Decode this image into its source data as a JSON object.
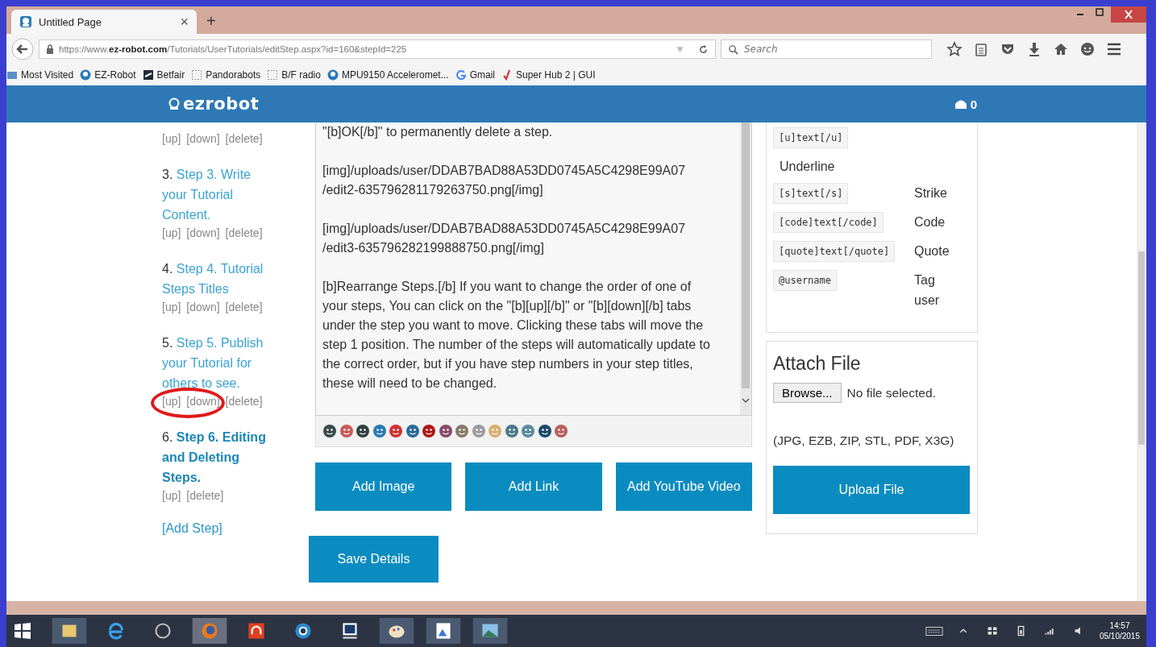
{
  "browser": {
    "tab": {
      "title": "Untitled Page",
      "close": "×"
    },
    "new_tab": "+",
    "url": {
      "prefix": "https://www.",
      "domain": "ez-robot.com",
      "path": "/Tutorials/UserTutorials/editStep.aspx?id=160&stepId=225"
    },
    "search": {
      "placeholder": "Search"
    },
    "bookmarks": [
      {
        "label": "Most Visited",
        "kind": "folder"
      },
      {
        "label": "EZ-Robot",
        "kind": "robot"
      },
      {
        "label": "Betfair",
        "kind": "square"
      },
      {
        "label": "Pandorabots",
        "kind": "blank"
      },
      {
        "label": "B/F radio",
        "kind": "blank"
      },
      {
        "label": "MPU9150 Acceleromet...",
        "kind": "robot"
      },
      {
        "label": "Gmail",
        "kind": "google"
      },
      {
        "label": "Super Hub 2 | GUI",
        "kind": "tick"
      }
    ]
  },
  "header": {
    "logo": "ezrobot",
    "cart_count": "0"
  },
  "steps": [
    {
      "actions": [
        "[up]",
        "[down]",
        "[delete]"
      ]
    },
    {
      "number": "3.",
      "title": "Step 3. Write your Tutorial Content.",
      "selected": false,
      "circled": false,
      "actions": [
        "[up]",
        "[down]",
        "[delete]"
      ]
    },
    {
      "number": "4.",
      "title": "Step 4. Tutorial Steps Titles",
      "selected": false,
      "circled": false,
      "actions": [
        "[up]",
        "[down]",
        "[delete]"
      ]
    },
    {
      "number": "5.",
      "title": "Step 5. Publish your Tutorial for others to see.",
      "selected": false,
      "circled": true,
      "actions": [
        "[up]",
        "[down]",
        "[delete]"
      ]
    },
    {
      "number": "6.",
      "title": "Step 6. Editing and Deleting Steps.",
      "selected": true,
      "circled": false,
      "actions": [
        "[up]",
        "[delete]"
      ]
    }
  ],
  "add_step": "[Add Step]",
  "editor": {
    "paragraphs": [
      "\"[b]OK[/b]\" to permanently delete a step.",
      "[img]/uploads/user/DDAB7BAD88A53DD0745A5C4298E99A07\n/edit2-635796281179263750.png[/img]",
      "[img]/uploads/user/DDAB7BAD88A53DD0745A5C4298E99A07\n/edit3-635796282199888750.png[/img]",
      "[b]Rearrange Steps.[/b] If you want to change the order of one of your steps, You can click on the \"[b][up][/b]\" or \"[b][down][/b] tabs under the step you want to move. Clicking these tabs will move the step 1 position. The number of the steps will automatically update to the correct order, but if you have step numbers in your step titles, these will need to be changed."
    ]
  },
  "buttons": [
    "Add Image",
    "Add Link",
    "Add YouTube Video"
  ],
  "save_button": "Save Details",
  "tags": [
    {
      "code": "[u]text[/u]",
      "label": "Underline",
      "kind": "stacked"
    },
    {
      "code": "[s]text[/s]",
      "label": "Strike",
      "kind": "inline"
    },
    {
      "code": "[code]text[/code]",
      "label": "Code",
      "kind": "inline"
    },
    {
      "code": "[quote]text[/quote]",
      "label": "Quote",
      "kind": "inline"
    },
    {
      "code": "@username",
      "label": "Tag user",
      "kind": "inline"
    }
  ],
  "attach": {
    "title": "Attach File",
    "browse": "Browse...",
    "file_status": "No file selected.",
    "formats": "(JPG, EZB, ZIP, STL, PDF, X3G)",
    "upload": "Upload File"
  },
  "taskbar": {
    "time": "14:57",
    "date": "05/10/2015"
  }
}
